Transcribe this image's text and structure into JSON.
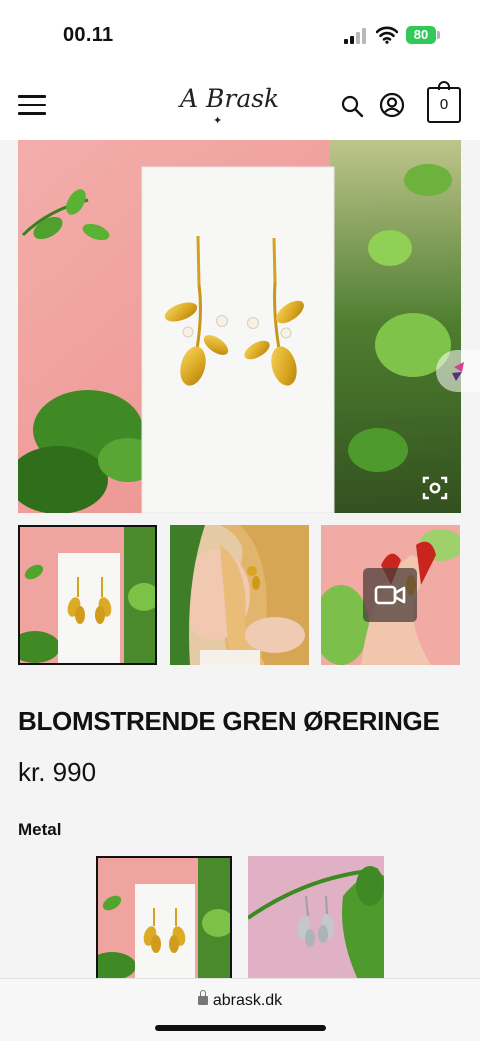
{
  "status_bar": {
    "time": "00.11",
    "battery": "80"
  },
  "header": {
    "logo_text": "A Brask",
    "cart_count": "0",
    "icons": [
      "menu-icon",
      "search-icon",
      "account-icon",
      "cart-icon"
    ]
  },
  "gallery": {
    "main_image": "gold-branch-earrings-on-white-card",
    "thumbnails": [
      "gold-earrings-card",
      "model-wearing-earrings",
      "earring-in-hand-video"
    ],
    "selected_thumbnail": 0
  },
  "product": {
    "title": "BLOMSTRENDE GREN ØRERINGE",
    "price": "kr. 990",
    "option_label": "Metal",
    "variants": [
      "gold",
      "silver"
    ],
    "selected_variant": "gold"
  },
  "browser": {
    "url": "abrask.dk"
  },
  "colors": {
    "pink": "#f1a2a0",
    "gold": "#d9a520",
    "leaf_green": "#4c9c2a",
    "battery_green": "#34c759"
  }
}
